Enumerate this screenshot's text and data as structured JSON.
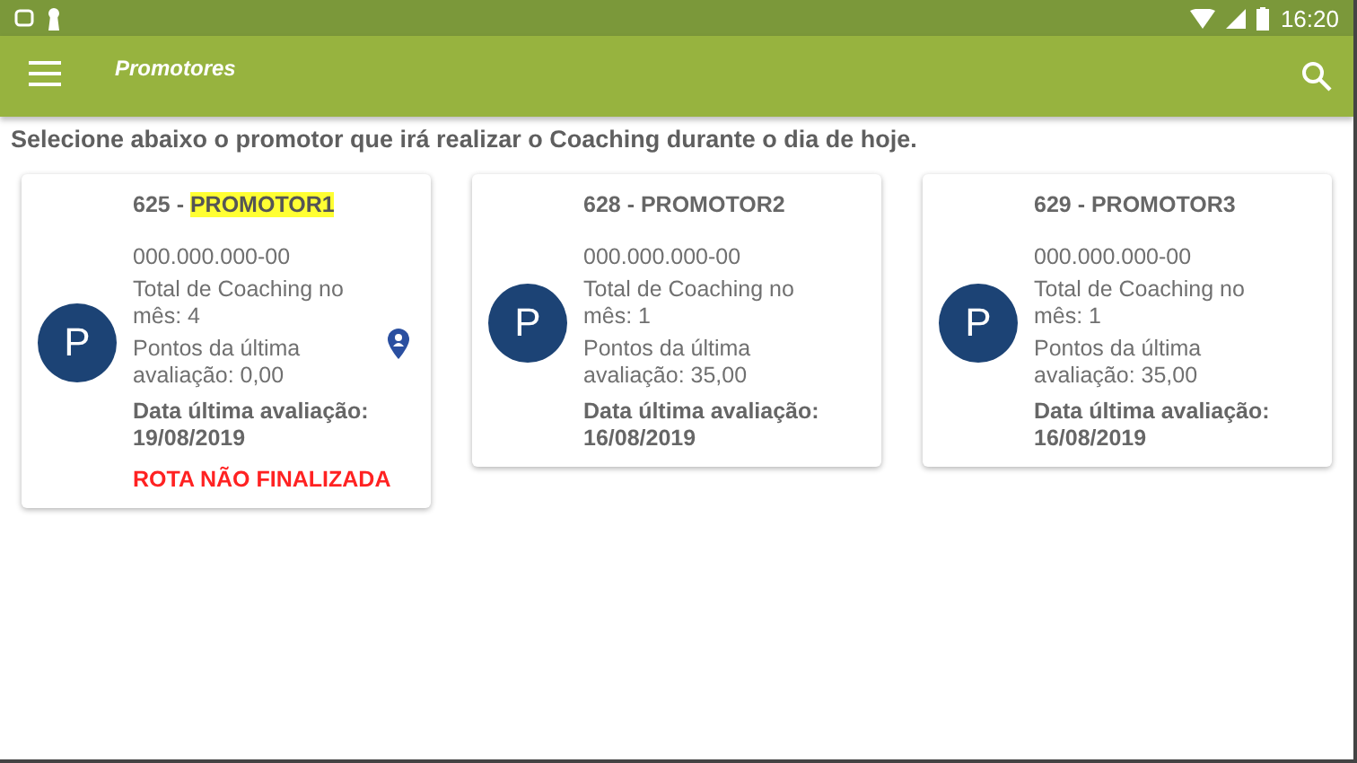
{
  "status_bar": {
    "time": "16:20"
  },
  "app_bar": {
    "title": "Promotores"
  },
  "instruction": "Selecione abaixo o promotor que irá realizar o Coaching durante o dia de hoje.",
  "cards": [
    {
      "avatar": "P",
      "code": "625 - ",
      "name": "PROMOTOR1",
      "highlighted": true,
      "document": "000.000.000-00",
      "total": "Total de Coaching no mês: 4",
      "points": "Pontos da última avaliação: 0,00",
      "date": "Data última avaliação: 19/08/2019",
      "location_marker": true,
      "status": "ROTA NÃO FINALIZADA"
    },
    {
      "avatar": "P",
      "code": "628 - ",
      "name": "PROMOTOR2",
      "highlighted": false,
      "document": "000.000.000-00",
      "total": "Total de Coaching no mês: 1",
      "points": "Pontos da última avaliação: 35,00",
      "date": "Data última avaliação: 16/08/2019",
      "location_marker": false
    },
    {
      "avatar": "P",
      "code": "629 - ",
      "name": "PROMOTOR3",
      "highlighted": false,
      "document": "000.000.000-00",
      "total": "Total de Coaching no mês: 1",
      "points": "Pontos da última avaliação: 35,00",
      "date": "Data última avaliação: 16/08/2019",
      "location_marker": false
    }
  ]
}
